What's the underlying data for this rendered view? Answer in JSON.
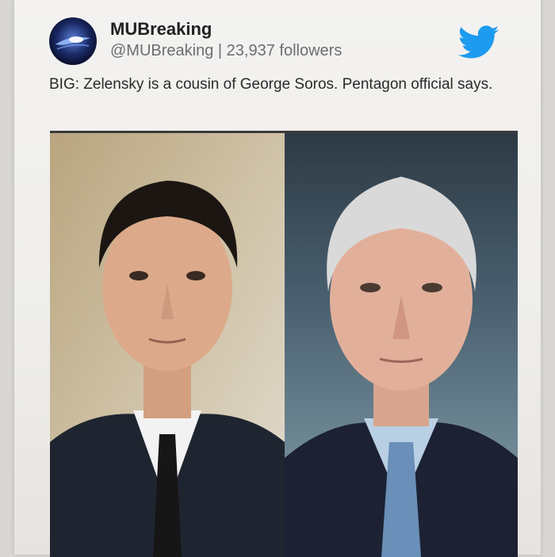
{
  "tweet": {
    "display_name": "MUBreaking",
    "handle": "@MUBreaking",
    "separator": "|",
    "followers": "23,937 followers",
    "text": "BIG: Zelensky is a cousin of George Soros. Pentagon official says."
  },
  "icons": {
    "avatar": "avatar",
    "platform": "twitter-bird-icon"
  },
  "colors": {
    "twitter_blue": "#1d9bf0",
    "name_color": "#222222",
    "meta_color": "#6a6e73"
  }
}
